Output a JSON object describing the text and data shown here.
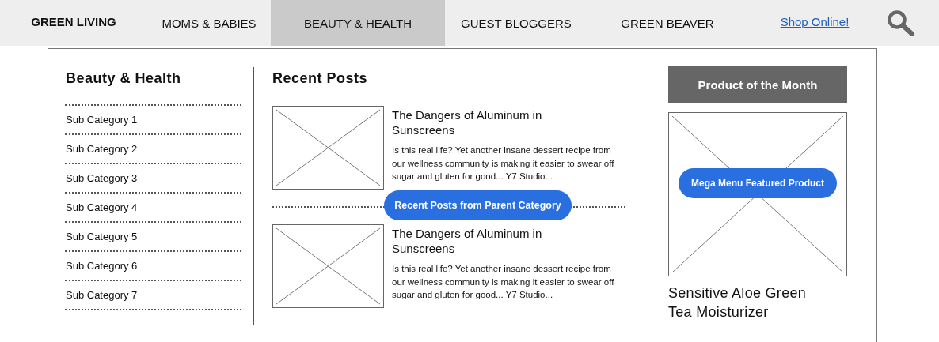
{
  "nav": {
    "tabs": [
      {
        "label": "GREEN LIVING",
        "selected": false
      },
      {
        "label": "MOMS & BABIES",
        "selected": false
      },
      {
        "label": "BEAUTY & HEALTH",
        "selected": true
      },
      {
        "label": "GUEST BLOGGERS",
        "selected": false
      },
      {
        "label": "GREEN BEAVER",
        "selected": false
      }
    ],
    "link": "Shop Online!"
  },
  "mega_menu": {
    "category": {
      "title": "Beauty & Health",
      "subcategories": [
        "Sub Category 1",
        "Sub Category 2",
        "Sub Category 3",
        "Sub Category 4",
        "Sub Category 5",
        "Sub Category 6",
        "Sub Category 7"
      ]
    },
    "recent_posts": {
      "title": "Recent Posts",
      "separator_label": "Recent Posts from Parent Category",
      "posts": [
        {
          "title": "The Dangers of Aluminum in Sunscreens",
          "excerpt": "Is this real life? Yet another insane dessert recipe from our wellness community is making it easier to swear off sugar and gluten for good... Y7 Studio..."
        },
        {
          "title": "The Dangers of Aluminum in Sunscreens",
          "excerpt": "Is this real life? Yet another insane dessert recipe from our wellness community is making it easier to swear off sugar and gluten for good... Y7 Studio..."
        }
      ]
    },
    "product": {
      "header": "Product of the Month",
      "badge": "Mega Menu Featured Product",
      "name": "Sensitive Aloe Green Tea Moisturizer"
    }
  }
}
